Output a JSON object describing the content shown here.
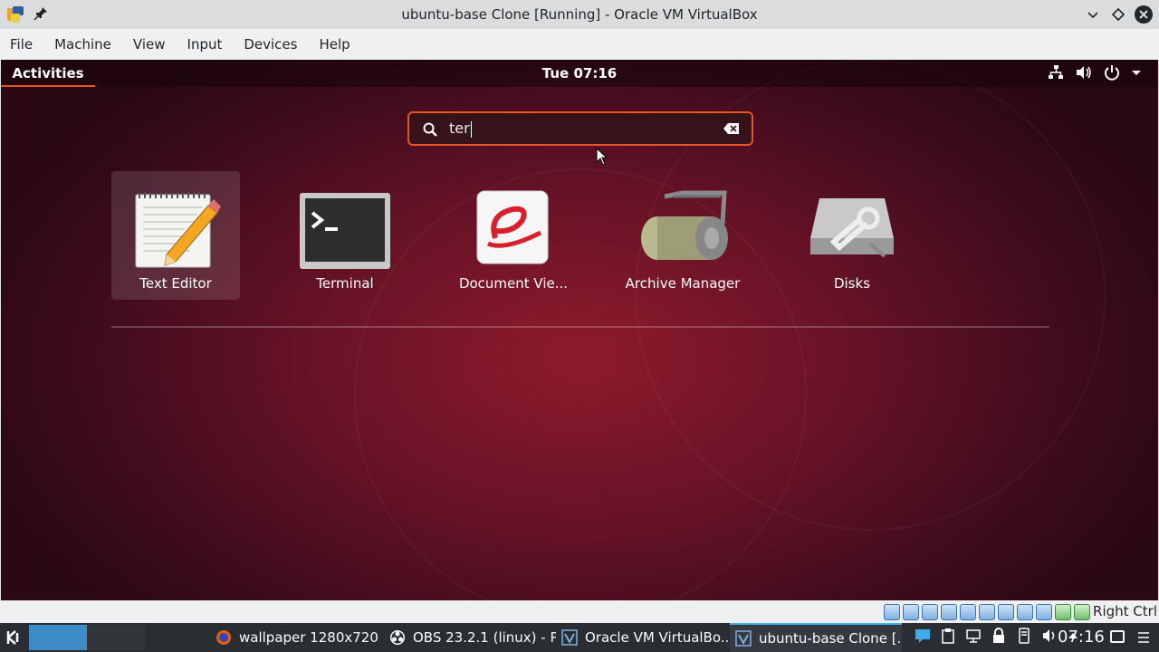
{
  "window": {
    "title": "ubuntu-base Clone [Running] - Oracle VM VirtualBox"
  },
  "menubar": {
    "items": [
      {
        "label": "File"
      },
      {
        "label": "Machine"
      },
      {
        "label": "View"
      },
      {
        "label": "Input"
      },
      {
        "label": "Devices"
      },
      {
        "label": "Help"
      }
    ]
  },
  "gnome": {
    "activities_label": "Activities",
    "clock": "Tue 07:16",
    "accent": "#e95420",
    "search": {
      "value": "ter"
    },
    "apps": [
      {
        "label": "Text Editor",
        "icon": "text-editor-icon",
        "selected": true
      },
      {
        "label": "Terminal",
        "icon": "terminal-icon",
        "selected": false
      },
      {
        "label": "Document Vie...",
        "icon": "document-viewer-icon",
        "selected": false
      },
      {
        "label": "Archive Manager",
        "icon": "archive-manager-icon",
        "selected": false
      },
      {
        "label": "Disks",
        "icon": "disks-icon",
        "selected": false
      }
    ]
  },
  "vbox_status": {
    "host_key": "Right Ctrl"
  },
  "taskbar": {
    "tasks": [
      {
        "label": "wallpaper 1280x720 ...",
        "icon": "firefox-icon"
      },
      {
        "label": "OBS 23.2.1 (linux) - P...",
        "icon": "obs-icon"
      },
      {
        "label": "Oracle VM VirtualBo...",
        "icon": "virtualbox-icon"
      },
      {
        "label": "ubuntu-base Clone [...",
        "icon": "virtualbox-icon"
      }
    ],
    "clock": "07:16"
  }
}
